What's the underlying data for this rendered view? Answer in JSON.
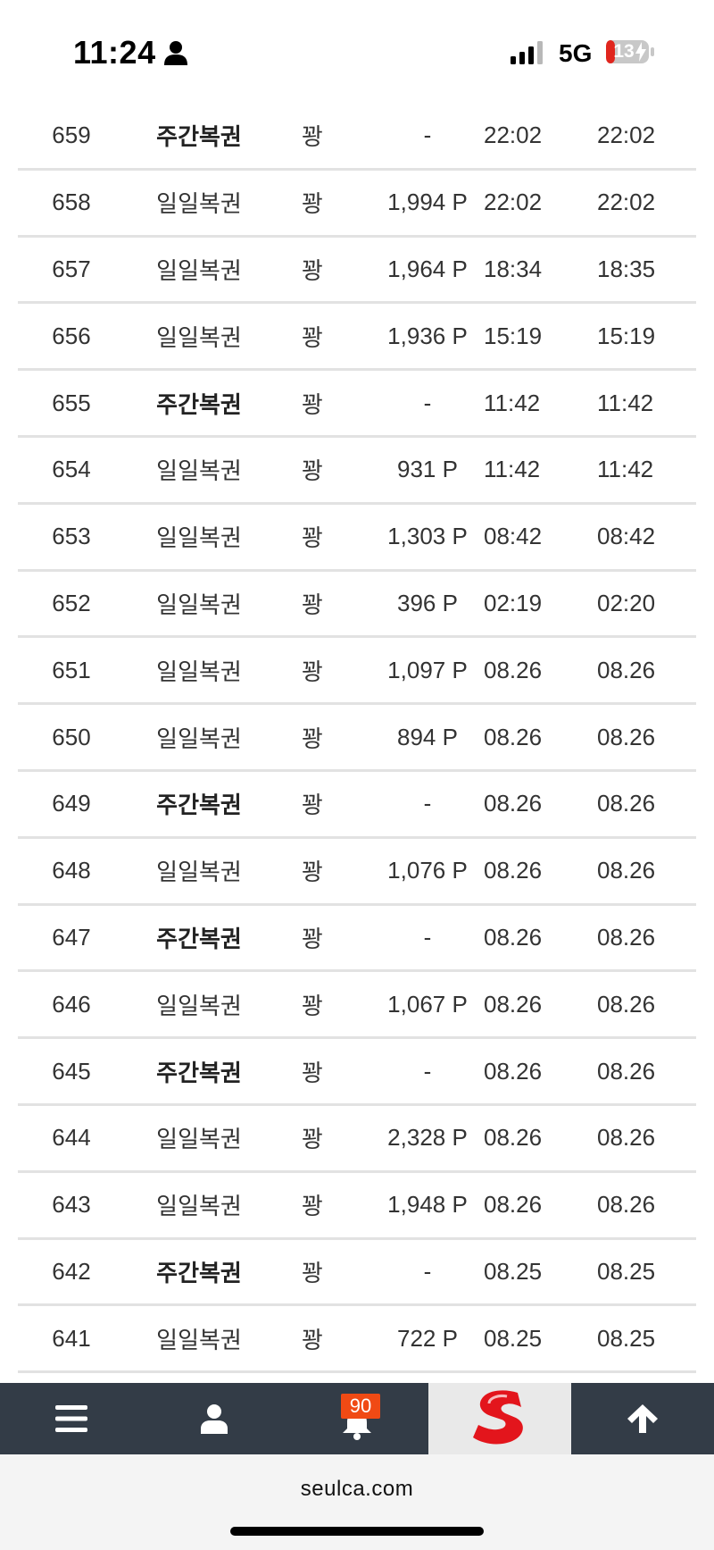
{
  "status_bar": {
    "time": "11:24",
    "network": "5G",
    "battery": "13"
  },
  "rows": [
    {
      "num": "659",
      "type": "주간복권",
      "bold": true,
      "result": "꽝",
      "point": "-",
      "t1": "22:02",
      "t2": "22:02"
    },
    {
      "num": "658",
      "type": "일일복권",
      "bold": false,
      "result": "꽝",
      "point": "1,994 P",
      "t1": "22:02",
      "t2": "22:02"
    },
    {
      "num": "657",
      "type": "일일복권",
      "bold": false,
      "result": "꽝",
      "point": "1,964 P",
      "t1": "18:34",
      "t2": "18:35"
    },
    {
      "num": "656",
      "type": "일일복권",
      "bold": false,
      "result": "꽝",
      "point": "1,936 P",
      "t1": "15:19",
      "t2": "15:19"
    },
    {
      "num": "655",
      "type": "주간복권",
      "bold": true,
      "result": "꽝",
      "point": "-",
      "t1": "11:42",
      "t2": "11:42"
    },
    {
      "num": "654",
      "type": "일일복권",
      "bold": false,
      "result": "꽝",
      "point": "931 P",
      "t1": "11:42",
      "t2": "11:42"
    },
    {
      "num": "653",
      "type": "일일복권",
      "bold": false,
      "result": "꽝",
      "point": "1,303 P",
      "t1": "08:42",
      "t2": "08:42"
    },
    {
      "num": "652",
      "type": "일일복권",
      "bold": false,
      "result": "꽝",
      "point": "396 P",
      "t1": "02:19",
      "t2": "02:20"
    },
    {
      "num": "651",
      "type": "일일복권",
      "bold": false,
      "result": "꽝",
      "point": "1,097 P",
      "t1": "08.26",
      "t2": "08.26"
    },
    {
      "num": "650",
      "type": "일일복권",
      "bold": false,
      "result": "꽝",
      "point": "894 P",
      "t1": "08.26",
      "t2": "08.26"
    },
    {
      "num": "649",
      "type": "주간복권",
      "bold": true,
      "result": "꽝",
      "point": "-",
      "t1": "08.26",
      "t2": "08.26"
    },
    {
      "num": "648",
      "type": "일일복권",
      "bold": false,
      "result": "꽝",
      "point": "1,076 P",
      "t1": "08.26",
      "t2": "08.26"
    },
    {
      "num": "647",
      "type": "주간복권",
      "bold": true,
      "result": "꽝",
      "point": "-",
      "t1": "08.26",
      "t2": "08.26"
    },
    {
      "num": "646",
      "type": "일일복권",
      "bold": false,
      "result": "꽝",
      "point": "1,067 P",
      "t1": "08.26",
      "t2": "08.26"
    },
    {
      "num": "645",
      "type": "주간복권",
      "bold": true,
      "result": "꽝",
      "point": "-",
      "t1": "08.26",
      "t2": "08.26"
    },
    {
      "num": "644",
      "type": "일일복권",
      "bold": false,
      "result": "꽝",
      "point": "2,328 P",
      "t1": "08.26",
      "t2": "08.26"
    },
    {
      "num": "643",
      "type": "일일복권",
      "bold": false,
      "result": "꽝",
      "point": "1,948 P",
      "t1": "08.26",
      "t2": "08.26"
    },
    {
      "num": "642",
      "type": "주간복권",
      "bold": true,
      "result": "꽝",
      "point": "-",
      "t1": "08.25",
      "t2": "08.25"
    },
    {
      "num": "641",
      "type": "일일복권",
      "bold": false,
      "result": "꽝",
      "point": "722 P",
      "t1": "08.25",
      "t2": "08.25"
    }
  ],
  "bottom_nav": {
    "items": [
      {
        "name": "menu",
        "icon": "hamburger-menu-icon"
      },
      {
        "name": "user",
        "icon": "user-icon"
      },
      {
        "name": "notifications",
        "icon": "bell-icon"
      },
      {
        "name": "home",
        "icon": "site-logo"
      },
      {
        "name": "scroll-top",
        "icon": "arrow-up-icon"
      }
    ],
    "notification_count": "90"
  },
  "browser": {
    "url": "seulca.com"
  },
  "colors": {
    "nav_bg": "#333c47",
    "badge": "#f04a14",
    "logo_red": "#e3151c",
    "divider": "#e2e2e2"
  }
}
